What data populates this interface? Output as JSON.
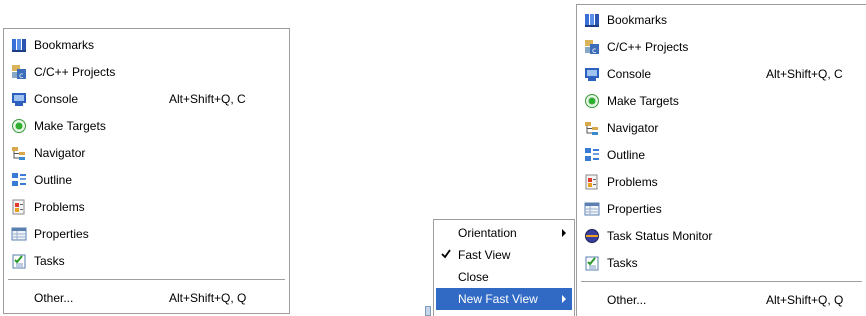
{
  "left_menu": {
    "items": [
      {
        "label": "Bookmarks",
        "icon": "bookmarks-icon"
      },
      {
        "label": "C/C++ Projects",
        "icon": "cpp-projects-icon"
      },
      {
        "label": "Console",
        "icon": "console-icon",
        "shortcut": "Alt+Shift+Q, C"
      },
      {
        "label": "Make Targets",
        "icon": "make-targets-icon"
      },
      {
        "label": "Navigator",
        "icon": "navigator-icon"
      },
      {
        "label": "Outline",
        "icon": "outline-icon"
      },
      {
        "label": "Problems",
        "icon": "problems-icon"
      },
      {
        "label": "Properties",
        "icon": "properties-icon"
      },
      {
        "label": "Tasks",
        "icon": "tasks-icon"
      }
    ],
    "other": {
      "label": "Other...",
      "shortcut": "Alt+Shift+Q, Q"
    }
  },
  "context_menu": {
    "items": [
      {
        "label": "Orientation",
        "submenu": true
      },
      {
        "label": "Fast View",
        "checked": true
      },
      {
        "label": "Close"
      },
      {
        "label": "New Fast View",
        "submenu": true,
        "selected": true
      }
    ]
  },
  "right_menu": {
    "items": [
      {
        "label": "Bookmarks",
        "icon": "bookmarks-icon"
      },
      {
        "label": "C/C++ Projects",
        "icon": "cpp-projects-icon"
      },
      {
        "label": "Console",
        "icon": "console-icon",
        "shortcut": "Alt+Shift+Q, C"
      },
      {
        "label": "Make Targets",
        "icon": "make-targets-icon"
      },
      {
        "label": "Navigator",
        "icon": "navigator-icon"
      },
      {
        "label": "Outline",
        "icon": "outline-icon"
      },
      {
        "label": "Problems",
        "icon": "problems-icon"
      },
      {
        "label": "Properties",
        "icon": "properties-icon"
      },
      {
        "label": "Task Status Monitor",
        "icon": "task-status-monitor-icon"
      },
      {
        "label": "Tasks",
        "icon": "tasks-icon"
      }
    ],
    "other": {
      "label": "Other...",
      "shortcut": "Alt+Shift+Q, Q"
    }
  },
  "colors": {
    "selection": "#316ac5",
    "border": "#9d9d9d"
  }
}
